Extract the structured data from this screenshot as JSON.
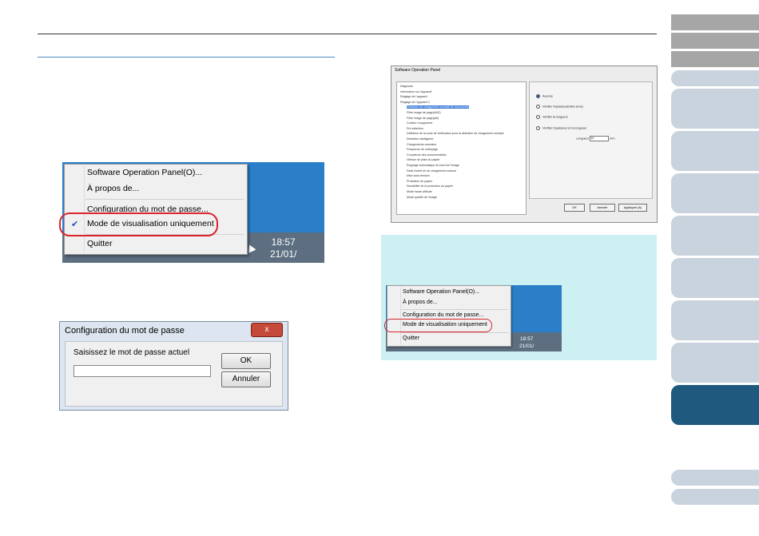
{
  "tabs": {
    "count": 13,
    "active_index": 10
  },
  "menu_left": {
    "items": [
      {
        "label": "Software Operation Panel(O)..."
      },
      {
        "label": "À propos de..."
      },
      {
        "label": "Configuration du mot de passe..."
      },
      {
        "label": "Mode de visualisation uniquement",
        "checked": true
      },
      {
        "label": "Quitter"
      }
    ],
    "clock_time": "18:57",
    "clock_date": "21/01/"
  },
  "password_dialog": {
    "title": "Configuration du mot de passe",
    "close_glyph": "x",
    "prompt": "Saisissez le mot de passe actuel",
    "input_value": "",
    "ok_label": "OK",
    "cancel_label": "Annuler"
  },
  "sop_window": {
    "title": "Software Operation Panel",
    "tree": [
      "Diagnosis",
      "Information sur l'appareil",
      "Réglage de l'appareil",
      "Réglage de l'appareil 2",
      "Détection de chargement excessif de documents",
      "Filtre image de page(AAD)",
      "Filtre image de page(ptb)",
      "Couleur à supprimer",
      "Pré-sélection",
      "Définition de la zone de vérification pour la détection de chargement multiple",
      "Détection intelligente",
      "Chargements autorisés",
      "Fréquence de nettoyage",
      "Compteurs des consommables",
      "Vitesse de prise du papier",
      "Rognage automatique du bord de l'image",
      "Délai d'arrêt de du chargement manuel",
      "Mise sous tension",
      "Protection du papier",
      "Sensibilité de la protection du papier",
      "Mode haute altitude",
      "Mode qualité de l'image"
    ],
    "selected_index": 4,
    "options": [
      {
        "label": "Aucune",
        "selected": true
      },
      {
        "label": "Vérifier l'épaisseur(Ultra sons)",
        "selected": false
      },
      {
        "label": "Vérifier la longueur",
        "selected": false
      },
      {
        "label": "Vérifier l'épaisseur et la longueur",
        "selected": false
      }
    ],
    "length_label": "Longueur",
    "length_value": "10",
    "length_unit": "mm",
    "buttons": {
      "ok": "OK",
      "cancel": "Annuler",
      "apply": "Appliquer (A)"
    }
  },
  "menu_right": {
    "items": [
      {
        "label": "Software Operation Panel(O)..."
      },
      {
        "label": "À propos de..."
      },
      {
        "label": "Configuration du mot de passe..."
      },
      {
        "label": "Mode de visualisation uniquement"
      },
      {
        "label": "Quitter"
      }
    ],
    "clock_time": "18:57",
    "clock_date": "21/01/"
  },
  "colors": {
    "tab_active": "#1f5a7e",
    "tab_light": "#c9d3de",
    "tab_gray": "#a6a6a6",
    "highlight": "#d9252c",
    "note_bg": "#cdf0f3",
    "desktop": "#2a7fc8"
  }
}
